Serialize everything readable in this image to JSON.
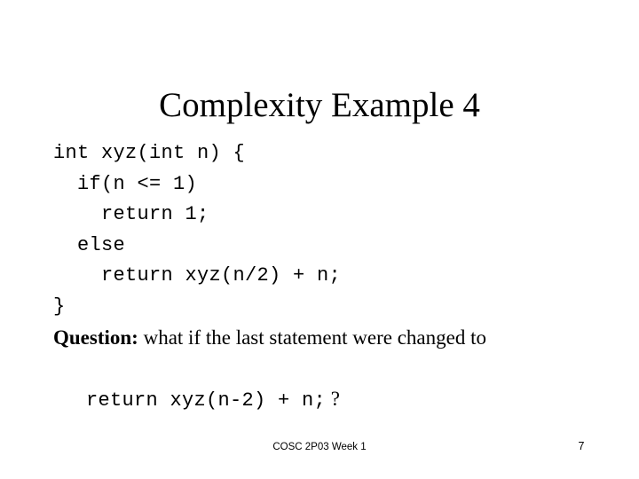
{
  "slide": {
    "title": "Complexity Example 4",
    "background_color": "#ffffff",
    "text_color": "#000000"
  },
  "code_block": {
    "lines": [
      "int xyz(int n) {",
      "  if(n <= 1)",
      "    return 1;",
      "  else",
      "    return xyz(n/2) + n;",
      "}"
    ]
  },
  "question": {
    "lead": "Question:",
    "text": " what if the last statement were changed to",
    "alternate_code": "return xyz(n-2) + n;",
    "suffix": " ?"
  },
  "footer": {
    "course": "COSC 2P03 Week 1",
    "page_number": "7"
  }
}
